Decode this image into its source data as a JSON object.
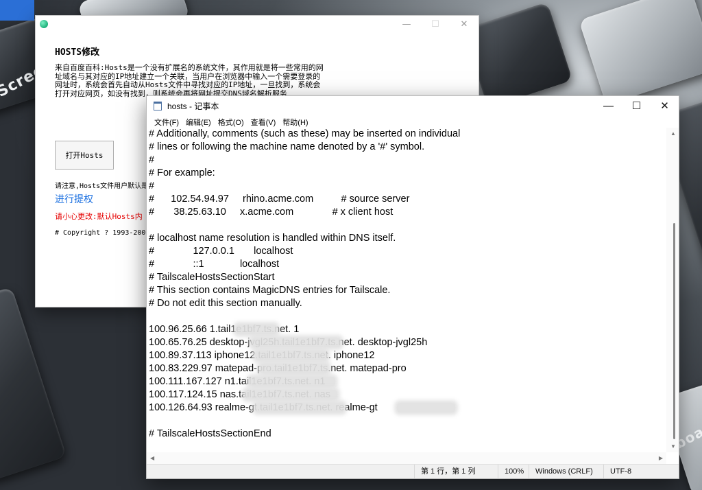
{
  "desktop": {
    "deco_labels": [
      "Screen",
      "Keyboard"
    ],
    "accent": "#2b6fd6"
  },
  "back_window": {
    "app_icon": "app-gem-icon",
    "controls": {
      "minimize": "—",
      "maximize": "☐",
      "close": "✕"
    },
    "title": "HOSTS修改",
    "description": "来自百度百科:Hosts是一个没有扩展名的系统文件，其作用就是将一些常用的网址域名与其对应的IP地址建立一个关联，当用户在浏览器中输入一个需要登录的网址时，系统会首先自动从Hosts文件中寻找对应的IP地址，一旦找到，系统会打开对应网页，如没有找到，则系统会再将网址提交DNS域名解析服务",
    "open_button": "打开Hosts",
    "note": "请注意,Hosts文件用户默认是",
    "elevate_link": "进行提权",
    "warning": "请小心更改:默认Hosts内",
    "copyright": "# Copyright ? 1993-200"
  },
  "notepad": {
    "title": "hosts - 记事本",
    "controls": {
      "minimize": "—",
      "maximize": "☐",
      "close": "✕"
    },
    "menu": [
      "文件(F)",
      "编辑(E)",
      "格式(O)",
      "查看(V)",
      "帮助(H)"
    ],
    "lines": [
      "# Additionally, comments (such as these) may be inserted on individual",
      "# lines or following the machine name denoted by a '#' symbol.",
      "#",
      "# For example:",
      "#",
      "#      102.54.94.97     rhino.acme.com          # source server",
      "#       38.25.63.10     x.acme.com              # x client host",
      "",
      "# localhost name resolution is handled within DNS itself.",
      "#              127.0.0.1       localhost",
      "#              ::1             localhost",
      "# TailscaleHostsSectionStart",
      "# This section contains MagicDNS entries for Tailscale.",
      "# Do not edit this section manually.",
      "",
      "100.96.25.66 1.tail1e1bf7.ts.net. 1",
      "100.65.76.25 desktop-jvgl25h.tail1e1bf7.ts.net. desktop-jvgl25h",
      "100.89.37.113 iphone12.tail1e1bf7.ts.net. iphone12",
      "100.83.229.97 matepad-pro.tail1e1bf7.ts.net. matepad-pro",
      "100.111.167.127 n1.tail1e1bf7.ts.net. n1",
      "100.117.124.15 nas.tail1e1bf7.ts.net. nas",
      "100.126.64.93 realme-gt.tail1e1bf7.ts.net. realme-gt",
      "",
      "# TailscaleHostsSectionEnd"
    ],
    "status": {
      "position": "第 1 行，第 1 列",
      "zoom": "100%",
      "line_ending": "Windows (CRLF)",
      "encoding": "UTF-8"
    }
  }
}
